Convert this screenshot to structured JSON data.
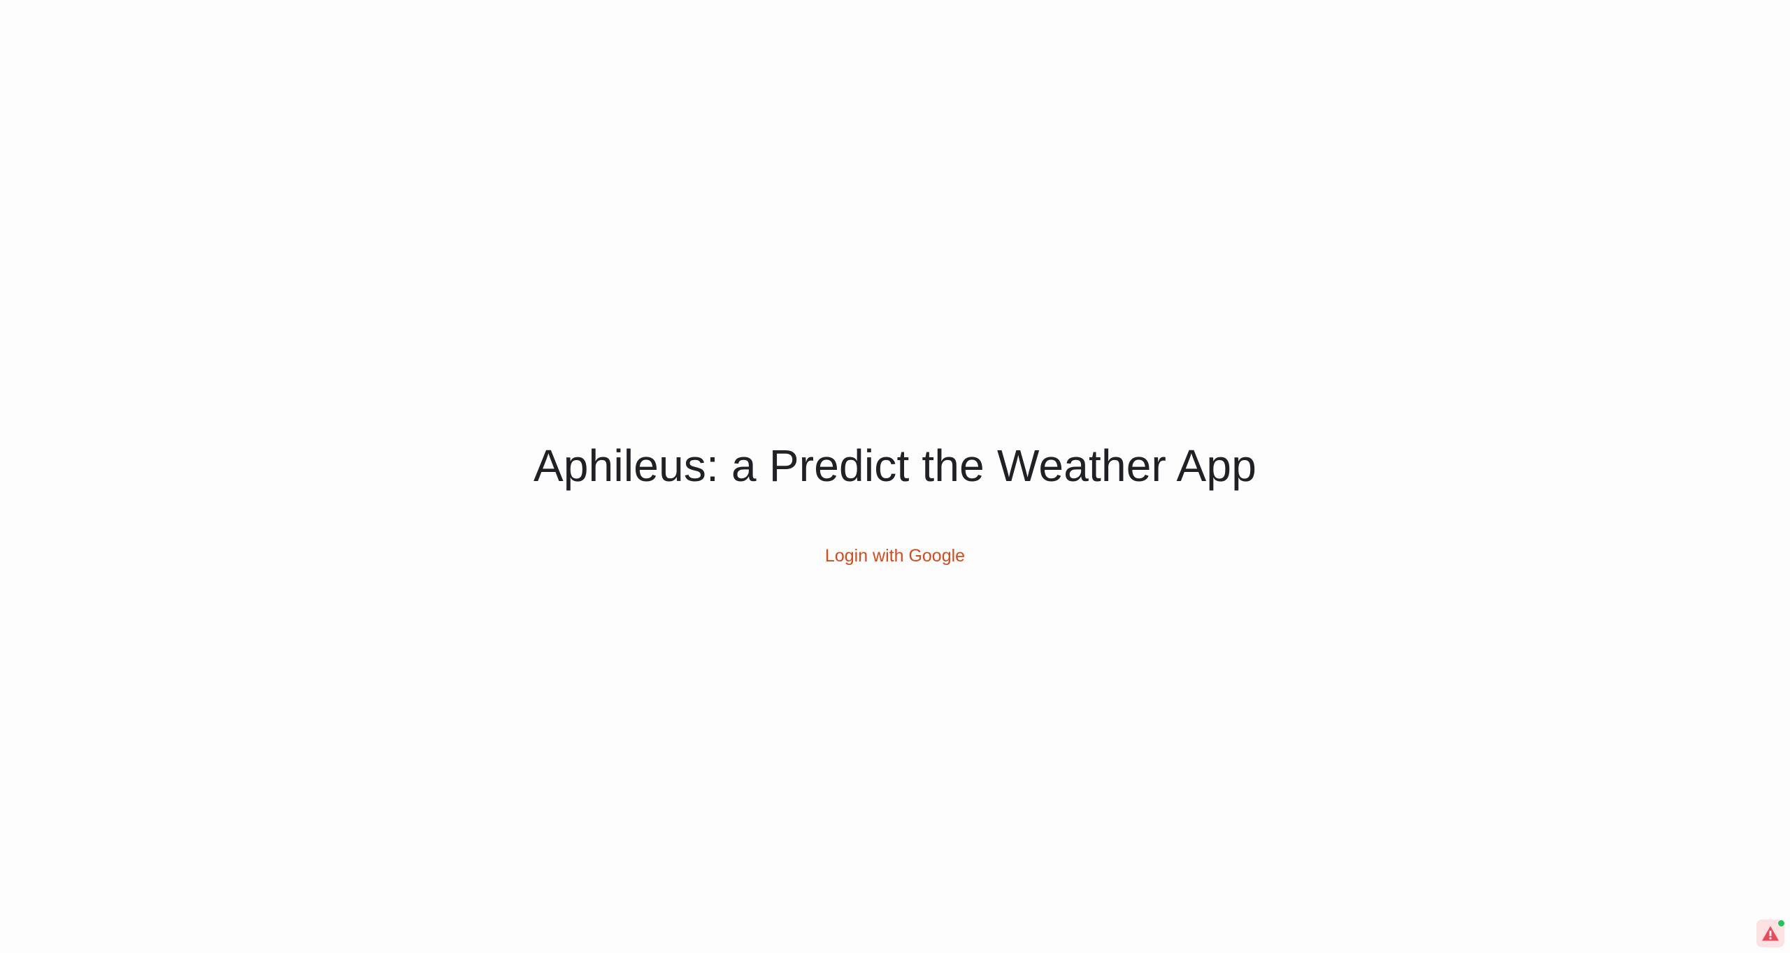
{
  "main": {
    "title": "Aphileus: a Predict the Weather App",
    "login_label": "Login with Google"
  },
  "colors": {
    "title_text": "#202124",
    "login_link": "#d84a1b",
    "badge_background": "#fde2e4",
    "badge_icon": "#ea4b5a",
    "status_dot": "#1ec75b"
  },
  "icons": {
    "badge": "warning-triangle-icon",
    "status": "status-dot"
  }
}
